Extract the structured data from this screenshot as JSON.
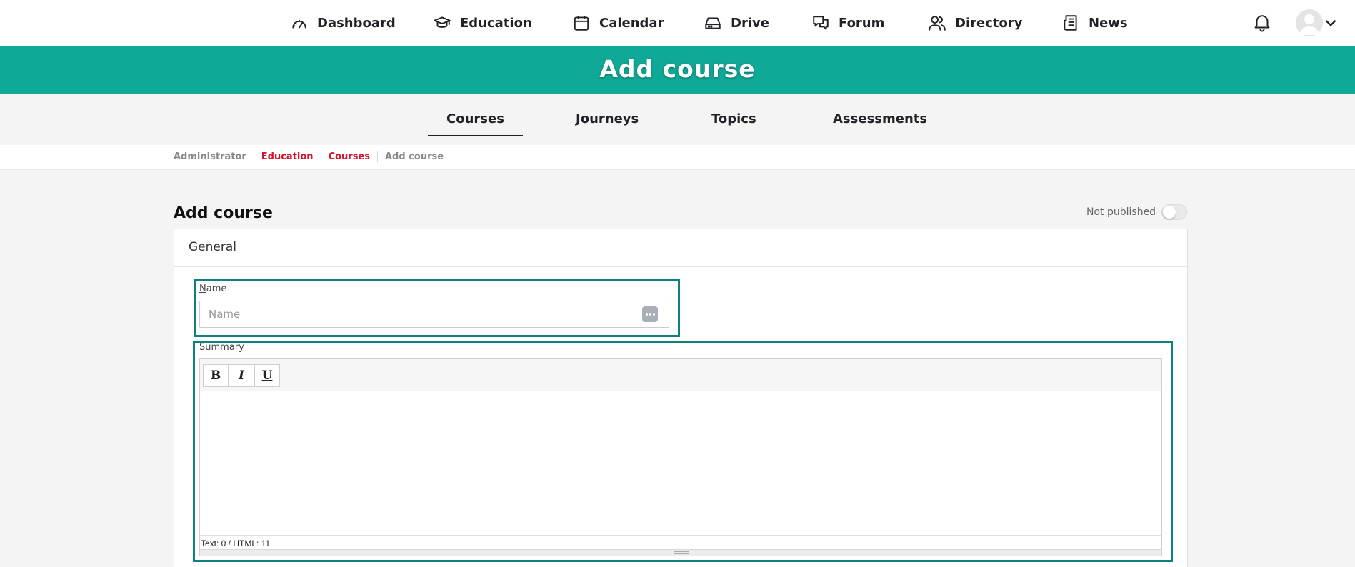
{
  "nav": {
    "items": [
      {
        "label": "Dashboard",
        "icon": "dashboard-gauge-icon"
      },
      {
        "label": "Education",
        "icon": "graduation-cap-icon"
      },
      {
        "label": "Calendar",
        "icon": "calendar-icon"
      },
      {
        "label": "Drive",
        "icon": "drive-icon"
      },
      {
        "label": "Forum",
        "icon": "chat-bubbles-icon"
      },
      {
        "label": "Directory",
        "icon": "users-icon"
      },
      {
        "label": "News",
        "icon": "newspaper-icon"
      }
    ]
  },
  "banner": {
    "title": "Add course"
  },
  "subnav": {
    "tabs": [
      {
        "label": "Courses",
        "active": true
      },
      {
        "label": "Journeys",
        "active": false
      },
      {
        "label": "Topics",
        "active": false
      },
      {
        "label": "Assessments",
        "active": false
      }
    ]
  },
  "breadcrumb": [
    "Administrator",
    "Education",
    "Courses",
    "Add course"
  ],
  "page": {
    "title": "Add course",
    "publish_label": "Not published",
    "published": false
  },
  "form": {
    "section_title": "General",
    "name": {
      "label_first": "N",
      "label_rest": "ame",
      "placeholder": "Name",
      "value": ""
    },
    "summary": {
      "label_first": "S",
      "label_rest": "ummary",
      "toolbar": {
        "bold": "B",
        "italic": "I",
        "underline": "U"
      },
      "status": "Text: 0 / HTML: 11"
    }
  },
  "colors": {
    "accent": "#10a896",
    "link": "#d2142c",
    "focus": "#0f8080"
  }
}
